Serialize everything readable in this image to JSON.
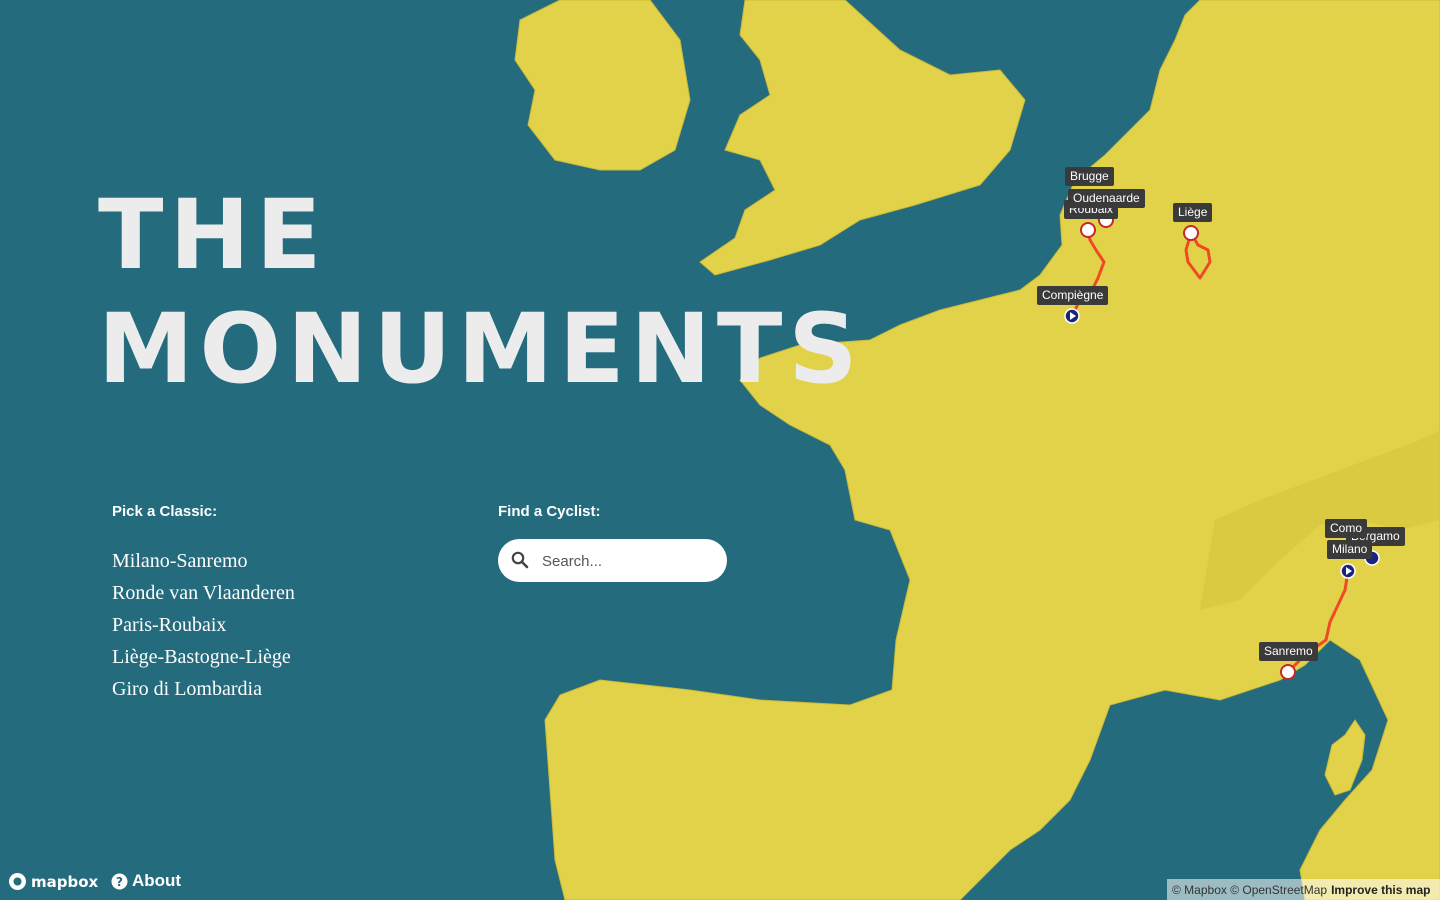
{
  "title": {
    "line1": "THE",
    "line2": "MONUMENTS"
  },
  "classics": {
    "label": "Pick a Classic:",
    "items": [
      "Milano-Sanremo",
      "Ronde van Vlaanderen",
      "Paris-Roubaix",
      "Liège-Bastogne-Liège",
      "Giro di Lombardia"
    ]
  },
  "cyclist": {
    "label": "Find a Cyclist:",
    "placeholder": "Search..."
  },
  "map": {
    "colors": {
      "water": "#246b7d",
      "land": "#e2d24a",
      "route": "#ef4a23",
      "label_bg": "#3a3a3a",
      "start_marker": "#1a237e"
    },
    "places": {
      "brugge": "Brugge",
      "oudenaarde": "Oudenaarde",
      "roubaix": "Roubaix",
      "liege": "Liège",
      "compiegne": "Compiègne",
      "como": "Como",
      "bergamo": "Bergamo",
      "milano": "Milano",
      "sanremo": "Sanremo"
    }
  },
  "footer": {
    "logo": "mapbox",
    "about": "About",
    "attribution": "© Mapbox © OpenStreetMap",
    "improve": "Improve this map"
  }
}
